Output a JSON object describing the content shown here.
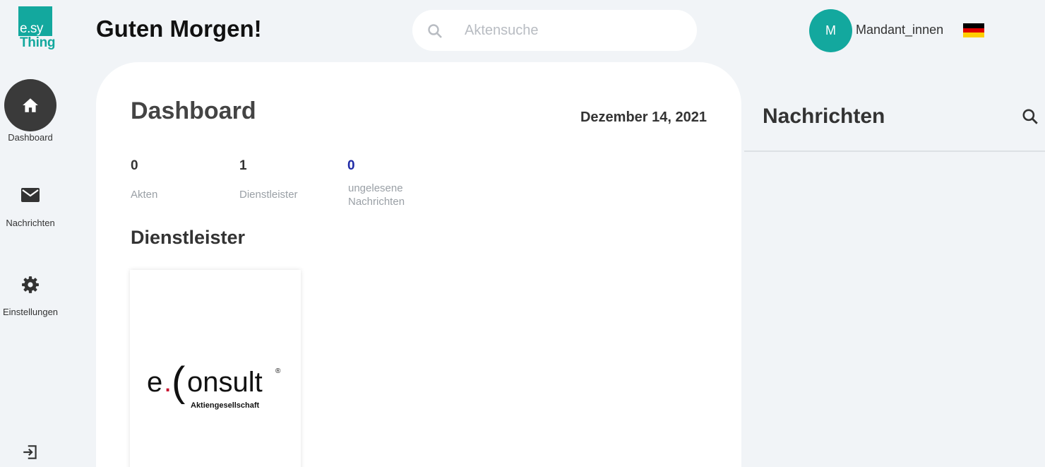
{
  "logo": {
    "line1": "e.sy",
    "line2": "Thing"
  },
  "header": {
    "greeting": "Guten Morgen!",
    "search_placeholder": "Aktensuche",
    "search_value": "",
    "user_initial": "M",
    "user_name": "Mandant_innen"
  },
  "sidebar": {
    "items": [
      {
        "label": "Dashboard",
        "icon": "home-icon",
        "active": true
      },
      {
        "label": "Nachrichten",
        "icon": "envelope-icon",
        "active": false
      },
      {
        "label": "Einstellungen",
        "icon": "gear-icon",
        "active": false
      }
    ],
    "logout_icon": "logout-icon"
  },
  "dashboard": {
    "title": "Dashboard",
    "date": "Dezember 14, 2021",
    "stats": [
      {
        "value": "0",
        "label": "Akten"
      },
      {
        "value": "1",
        "label": "Dienstleister"
      },
      {
        "value": "0",
        "label_line1": "ungelesene",
        "label_line2": "Nachrichten"
      }
    ],
    "providers_title": "Dienstleister",
    "provider": {
      "logo_text_prefix": "e",
      "logo_text_dot": ".",
      "logo_text_paren": "(",
      "logo_text_main": "onsult",
      "logo_registered": "®",
      "logo_subtitle": "Aktiengesellschaft"
    }
  },
  "messages_panel": {
    "title": "Nachrichten"
  },
  "colors": {
    "background": "#f1f4f7",
    "accent": "#13a89e",
    "active_nav": "#3a3a3a",
    "unread_count": "#1f2aa6",
    "logo_dot": "#c8102e"
  }
}
